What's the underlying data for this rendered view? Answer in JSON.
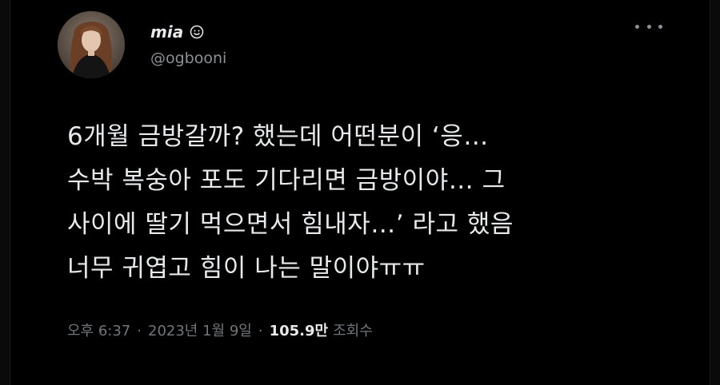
{
  "user": {
    "display_name": "mia",
    "handle": "@ogbooni",
    "badge_icon": "smiley-face-icon"
  },
  "tweet": {
    "lines": [
      "6개월 금방갈까? 했는데 어떤분이 ‘응…",
      "수박 복숭아 포도 기다리면 금방이야… 그",
      "사이에 딸기 먹으면서 힘내자…’ 라고 했음",
      "너무 귀엽고 힘이 나는 말이야ㅠㅠ"
    ]
  },
  "meta": {
    "time": "오후 6:37",
    "separator": "·",
    "date": "2023년 1월 9일",
    "views_count": "105.9만",
    "views_label": "조회수"
  },
  "colors": {
    "background": "#000000",
    "text_primary": "#e7e9ea",
    "text_secondary": "#71767b"
  },
  "icons": {
    "more": "more-options-icon",
    "badge": "smiley-face-icon"
  }
}
